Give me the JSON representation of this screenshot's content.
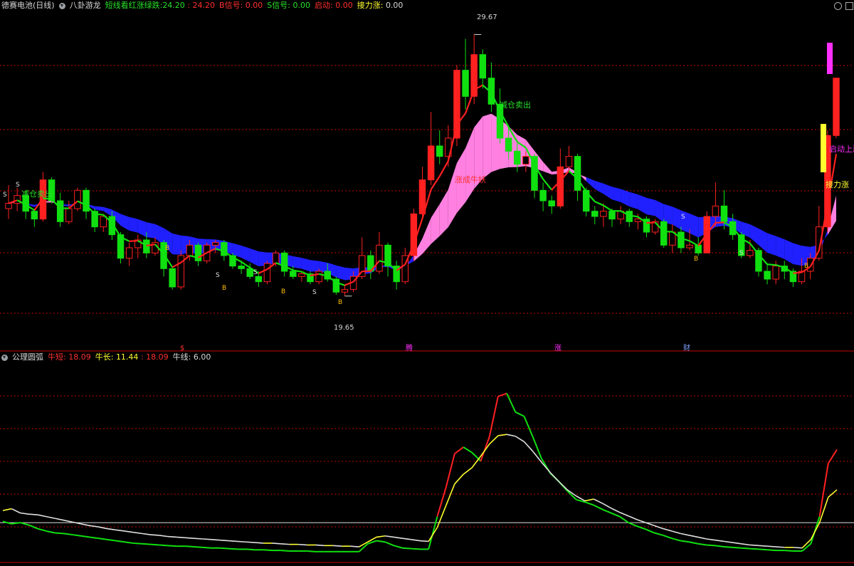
{
  "main_header": {
    "stock": "德赛电池(日线)",
    "indicator": "八卦游龙",
    "legend_label": "短线看红涨绿跌:",
    "legend_value1": "24.20",
    "legend_sep": ":",
    "legend_value2": "24.20",
    "b_label": "B信号:",
    "b_value": "0.00",
    "s_label": "S信号:",
    "s_value": "0.00",
    "start_label": "启动:",
    "start_value": "0.00",
    "pull_label": "接力涨:",
    "pull_value": "0.00"
  },
  "sub_header": {
    "indicator": "公理圆弧",
    "short_label": "牛短:",
    "short_value": "18.09",
    "long_label": "牛长:",
    "long_value": "11.44",
    "long_extra": ": 18.09",
    "line_label": "牛线:",
    "line_value": "6.00"
  },
  "annotations": {
    "high": "29.67",
    "low": "19.65",
    "sell1": "减仓卖出",
    "sell2": "减仓卖出",
    "bull": "涨成牛妖",
    "start_up": "启动上涨",
    "relay": "接力涨",
    "bottom_left": "$",
    "bottom_teng": "腾",
    "bottom_zhang": "涨",
    "bottom_cai": "财",
    "s1": "S",
    "s2": "S",
    "s3": "S",
    "s4": "S",
    "s5": "S",
    "s6": "S",
    "s7": "S",
    "b1": "B",
    "b2": "B",
    "b3": "B",
    "b4": "B",
    "b5": "B",
    "b6": "B"
  },
  "colors": {
    "up": "#ff2020",
    "down": "#10e010",
    "ribbon_up": "#ff80e0",
    "ribbon_down": "#2020ff",
    "axis_red": "#c00000",
    "white_line": "#e0e0e0",
    "yellow": "#ffff30",
    "magenta": "#ff30ff"
  },
  "chart_data": [
    {
      "type": "candlestick",
      "title": "八卦游龙",
      "high_label": 29.67,
      "low_label": 19.65,
      "ylim": [
        18.5,
        30.5
      ],
      "candles": [
        [
          23.0,
          23.2,
          22.6,
          23.9
        ],
        [
          23.2,
          23.5,
          22.9,
          23.8
        ],
        [
          23.5,
          22.9,
          22.6,
          23.7
        ],
        [
          22.9,
          22.6,
          22.3,
          23.0
        ],
        [
          22.6,
          24.1,
          22.5,
          24.4
        ],
        [
          24.1,
          23.3,
          23.2,
          24.2
        ],
        [
          23.3,
          22.5,
          22.3,
          23.6
        ],
        [
          22.5,
          23.0,
          22.4,
          23.3
        ],
        [
          23.0,
          23.7,
          22.9,
          23.8
        ],
        [
          23.7,
          22.9,
          22.6,
          23.8
        ],
        [
          22.9,
          22.3,
          22.1,
          23.0
        ],
        [
          22.3,
          22.7,
          22.1,
          22.8
        ],
        [
          22.7,
          22.0,
          21.8,
          22.9
        ],
        [
          22.0,
          21.1,
          20.9,
          22.1
        ],
        [
          21.1,
          21.5,
          20.8,
          21.7
        ],
        [
          21.5,
          21.8,
          21.1,
          22.0
        ],
        [
          21.8,
          21.3,
          21.1,
          22.1
        ],
        [
          21.3,
          21.7,
          21.2,
          21.9
        ],
        [
          21.7,
          20.7,
          20.4,
          21.8
        ],
        [
          20.7,
          20.0,
          19.9,
          20.8
        ],
        [
          20.0,
          21.2,
          19.9,
          21.4
        ],
        [
          21.2,
          21.6,
          21.0,
          21.8
        ],
        [
          21.6,
          21.0,
          20.8,
          21.7
        ],
        [
          21.0,
          21.6,
          20.9,
          21.7
        ],
        [
          21.6,
          21.7,
          21.3,
          21.8
        ],
        [
          21.7,
          21.2,
          21.0,
          21.8
        ],
        [
          21.2,
          20.8,
          20.7,
          21.3
        ],
        [
          20.8,
          20.7,
          20.5,
          21.0
        ],
        [
          20.7,
          20.4,
          20.3,
          20.9
        ],
        [
          20.4,
          20.2,
          20.0,
          20.6
        ],
        [
          20.2,
          20.9,
          20.1,
          21.0
        ],
        [
          20.9,
          21.3,
          20.8,
          21.4
        ],
        [
          21.3,
          20.6,
          20.4,
          21.4
        ],
        [
          20.6,
          20.4,
          20.3,
          20.8
        ],
        [
          20.4,
          20.5,
          20.2,
          20.6
        ],
        [
          20.5,
          20.2,
          20.1,
          20.6
        ],
        [
          20.2,
          20.6,
          20.1,
          20.7
        ],
        [
          20.6,
          20.3,
          20.2,
          20.9
        ],
        [
          20.3,
          19.8,
          19.7,
          20.4
        ],
        [
          19.8,
          19.9,
          19.65,
          20.1
        ],
        [
          19.9,
          20.4,
          19.8,
          20.6
        ],
        [
          20.4,
          21.2,
          20.3,
          21.9
        ],
        [
          21.2,
          20.6,
          20.3,
          21.4
        ],
        [
          20.6,
          21.6,
          20.5,
          22.1
        ],
        [
          21.6,
          20.8,
          20.4,
          21.7
        ],
        [
          20.8,
          20.2,
          19.9,
          21.0
        ],
        [
          20.2,
          21.2,
          20.1,
          21.5
        ],
        [
          21.2,
          22.8,
          21.0,
          23.0
        ],
        [
          22.8,
          24.1,
          22.6,
          24.6
        ],
        [
          24.1,
          25.4,
          23.9,
          26.7
        ],
        [
          25.4,
          25.0,
          24.7,
          26.0
        ],
        [
          25.0,
          25.7,
          24.6,
          26.2
        ],
        [
          25.7,
          28.3,
          25.4,
          28.5
        ],
        [
          28.3,
          27.3,
          26.8,
          29.5
        ],
        [
          27.3,
          28.9,
          27.0,
          29.67
        ],
        [
          28.9,
          28.0,
          27.6,
          29.1
        ],
        [
          28.0,
          27.0,
          26.7,
          28.6
        ],
        [
          27.0,
          25.7,
          25.5,
          27.6
        ],
        [
          25.7,
          25.2,
          24.9,
          26.2
        ],
        [
          25.2,
          24.7,
          24.4,
          25.5
        ],
        [
          24.7,
          25.0,
          24.4,
          25.2
        ],
        [
          25.0,
          23.7,
          23.4,
          25.1
        ],
        [
          23.7,
          23.3,
          22.9,
          24.0
        ],
        [
          23.3,
          23.1,
          22.8,
          23.5
        ],
        [
          23.1,
          24.6,
          23.0,
          25.3
        ],
        [
          24.6,
          25.0,
          24.4,
          25.4
        ],
        [
          25.0,
          23.7,
          23.3,
          25.1
        ],
        [
          23.7,
          22.9,
          22.7,
          23.8
        ],
        [
          22.9,
          22.7,
          22.4,
          23.1
        ],
        [
          22.7,
          22.9,
          22.3,
          23.2
        ],
        [
          22.9,
          22.6,
          22.3,
          23.0
        ],
        [
          22.6,
          22.9,
          22.4,
          23.1
        ],
        [
          22.9,
          22.5,
          22.3,
          23.0
        ],
        [
          22.5,
          22.6,
          22.2,
          22.8
        ],
        [
          22.6,
          22.1,
          21.9,
          22.7
        ],
        [
          22.1,
          22.5,
          22.0,
          22.6
        ],
        [
          22.5,
          21.6,
          21.5,
          22.6
        ],
        [
          21.6,
          22.1,
          21.3,
          22.4
        ],
        [
          22.1,
          21.5,
          21.3,
          22.3
        ],
        [
          21.5,
          21.6,
          21.4,
          22.2
        ],
        [
          21.6,
          21.3,
          21.2,
          21.9
        ],
        [
          21.3,
          22.7,
          21.3,
          22.9
        ],
        [
          22.7,
          23.1,
          22.3,
          24.0
        ],
        [
          23.1,
          22.5,
          22.2,
          23.7
        ],
        [
          22.5,
          22.0,
          21.8,
          22.8
        ],
        [
          22.0,
          21.2,
          21.1,
          22.1
        ],
        [
          21.2,
          21.4,
          21.1,
          21.8
        ],
        [
          21.4,
          20.6,
          20.4,
          21.5
        ],
        [
          20.6,
          20.3,
          20.1,
          20.9
        ],
        [
          20.3,
          20.8,
          20.1,
          21.0
        ],
        [
          20.8,
          20.6,
          20.3,
          21.0
        ],
        [
          20.6,
          20.2,
          20.0,
          20.7
        ],
        [
          20.2,
          20.6,
          20.1,
          21.1
        ],
        [
          20.6,
          21.1,
          20.3,
          21.3
        ],
        [
          21.1,
          22.3,
          21.0,
          23.1
        ],
        [
          22.3,
          25.8,
          22.1,
          26.0
        ],
        [
          25.8,
          28.0,
          25.7,
          28.0
        ]
      ]
    },
    {
      "type": "line",
      "title": "公理圆弧",
      "series": [
        {
          "name": "牛短",
          "values": [
            6.2,
            5.8,
            6.0,
            5.6,
            5.0,
            4.6,
            4.3,
            4.2,
            4.0,
            3.8,
            3.6,
            3.4,
            3.2,
            3.0,
            2.8,
            2.6,
            2.5,
            2.4,
            2.3,
            2.2,
            2.1,
            2.1,
            2.0,
            1.9,
            1.8,
            1.8,
            1.7,
            1.6,
            1.6,
            1.5,
            1.5,
            1.4,
            1.4,
            1.3,
            1.3,
            1.3,
            1.2,
            1.2,
            1.2,
            1.2,
            1.2,
            1.2,
            2.5,
            3.0,
            2.8,
            2.2,
            1.8,
            1.7,
            1.6,
            1.6,
            7.0,
            11.8,
            17.4,
            18.5,
            17.6,
            16.2,
            20.2,
            26.9,
            27.4,
            24.3,
            23.6,
            20.2,
            16.6,
            14.2,
            12.8,
            11.2,
            9.8,
            9.4,
            8.9,
            8.2,
            7.6,
            7.0,
            6.0,
            5.4,
            4.9,
            4.3,
            3.9,
            3.4,
            3.0,
            2.8,
            2.5,
            2.3,
            2.2,
            2.0,
            1.9,
            1.8,
            1.7,
            1.6,
            1.5,
            1.4,
            1.4,
            1.3,
            1.3,
            2.5,
            7.0,
            15.8,
            18.09
          ]
        },
        {
          "name": "牛长",
          "values": [
            8.0,
            8.3,
            7.6,
            7.4,
            7.3,
            7.0,
            6.7,
            6.4,
            6.1,
            5.8,
            5.5,
            5.3,
            5.0,
            4.8,
            4.6,
            4.4,
            4.2,
            4.0,
            3.9,
            3.7,
            3.6,
            3.5,
            3.4,
            3.3,
            3.2,
            3.1,
            3.0,
            2.9,
            2.8,
            2.7,
            2.6,
            2.6,
            2.5,
            2.4,
            2.4,
            2.3,
            2.3,
            2.2,
            2.2,
            2.1,
            2.1,
            2.0,
            2.8,
            3.6,
            3.8,
            3.6,
            3.4,
            3.2,
            3.0,
            2.9,
            5.2,
            8.8,
            12.4,
            14.0,
            15.1,
            17.0,
            19.0,
            20.4,
            20.6,
            20.3,
            19.4,
            17.8,
            16.0,
            14.3,
            12.8,
            11.4,
            10.4,
            9.6,
            9.9,
            9.2,
            8.4,
            7.7,
            7.1,
            6.5,
            6.0,
            5.5,
            5.0,
            4.6,
            4.2,
            3.9,
            3.6,
            3.3,
            3.1,
            2.9,
            2.7,
            2.5,
            2.3,
            2.2,
            2.1,
            2.0,
            1.9,
            1.9,
            1.8,
            3.2,
            6.0,
            10.2,
            11.44
          ]
        }
      ],
      "horizontal_line": 6.0,
      "ylim": [
        0,
        33
      ]
    }
  ]
}
